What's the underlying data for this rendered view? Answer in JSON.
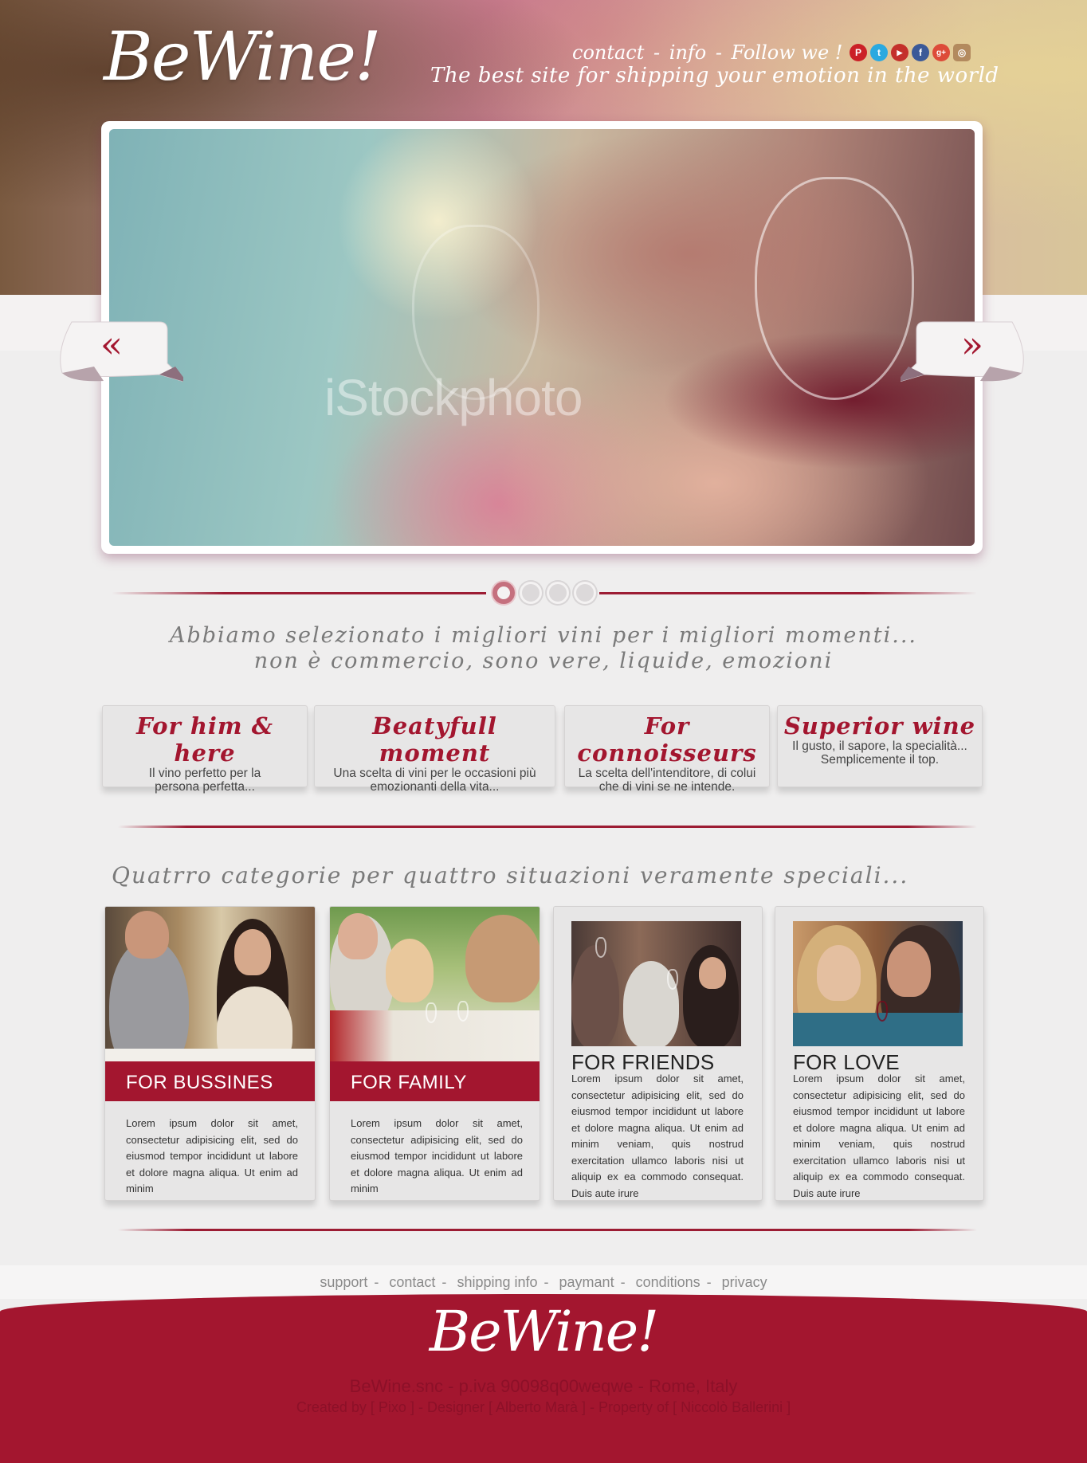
{
  "header": {
    "logo": "BeWine!",
    "links": [
      "contact",
      "info",
      "Follow we !"
    ],
    "link_separator": "-",
    "tagline": "The best site for shipping your emotion in the world",
    "social": [
      {
        "name": "pinterest-icon",
        "glyph": "P",
        "color": "#cb2027"
      },
      {
        "name": "twitter-icon",
        "glyph": "t",
        "color": "#2aa9e0"
      },
      {
        "name": "youtube-icon",
        "glyph": "▶",
        "color": "#c4302b"
      },
      {
        "name": "facebook-icon",
        "glyph": "f",
        "color": "#3b5998"
      },
      {
        "name": "googleplus-icon",
        "glyph": "g+",
        "color": "#dd4b39"
      },
      {
        "name": "instagram-icon",
        "glyph": "◎",
        "color": "#b38a5e"
      }
    ]
  },
  "slider": {
    "watermark": "iStockphoto",
    "prev_glyph": "«",
    "next_glyph": "»",
    "slide_count": 4,
    "active_slide": 1
  },
  "intro": {
    "line1": "Abbiamo selezionato i migliori vini per i migliori momenti...",
    "line2": "non è commercio, sono vere, liquide, emozioni"
  },
  "features": [
    {
      "title": "For him & here",
      "text": "Il vino perfetto per la persona perfetta..."
    },
    {
      "title": "Beatyfull moment",
      "text": "Una scelta di vini per le occasioni più emozionanti della vita..."
    },
    {
      "title": "For connoisseurs",
      "text": "La scelta dell'intenditore, di colui che di vini se ne intende."
    },
    {
      "title": "Superior wine",
      "text": "Il gusto, il sapore, la specialità... Semplicemente il top."
    }
  ],
  "categories_title": "Quatrro categorie per quattro situazioni veramente speciali...",
  "categories": [
    {
      "label": "FOR BUSSINES",
      "text": "Lorem ipsum dolor sit amet, consectetur adipisicing elit, sed do eiusmod tempor incididunt ut labore et dolore magna aliqua. Ut enim ad minim"
    },
    {
      "label": "FOR FAMILY",
      "text": "Lorem ipsum dolor sit amet, consectetur adipisicing elit, sed do eiusmod tempor incididunt ut labore et dolore magna aliqua. Ut enim ad minim"
    },
    {
      "label": "FOR FRIENDS",
      "text": "Lorem ipsum dolor sit amet, consectetur adipisicing elit, sed do eiusmod tempor incididunt ut labore et dolore magna aliqua. Ut enim ad minim veniam, quis nostrud exercitation ullamco laboris nisi ut aliquip ex ea commodo consequat. Duis aute irure"
    },
    {
      "label": "FOR LOVE",
      "text": "Lorem ipsum dolor sit amet, consectetur adipisicing elit, sed do eiusmod tempor incididunt ut labore et dolore magna aliqua. Ut enim ad minim veniam, quis nostrud exercitation ullamco laboris nisi ut aliquip ex ea commodo consequat. Duis aute irure"
    }
  ],
  "footer": {
    "links": [
      "support",
      "contact",
      "shipping info",
      "paymant",
      "conditions",
      "privacy"
    ],
    "logo": "BeWine!",
    "company": "BeWine.snc - p.iva 90098q00weqwe - Rome, Italy",
    "credits": "Created by [ Pixo ] - Designer [ Alberto Marà ] - Property of [ Niccolò Ballerini ]"
  },
  "colors": {
    "brand": "#a3162f",
    "background": "#efeeee",
    "text_muted": "#7a7a7a"
  }
}
